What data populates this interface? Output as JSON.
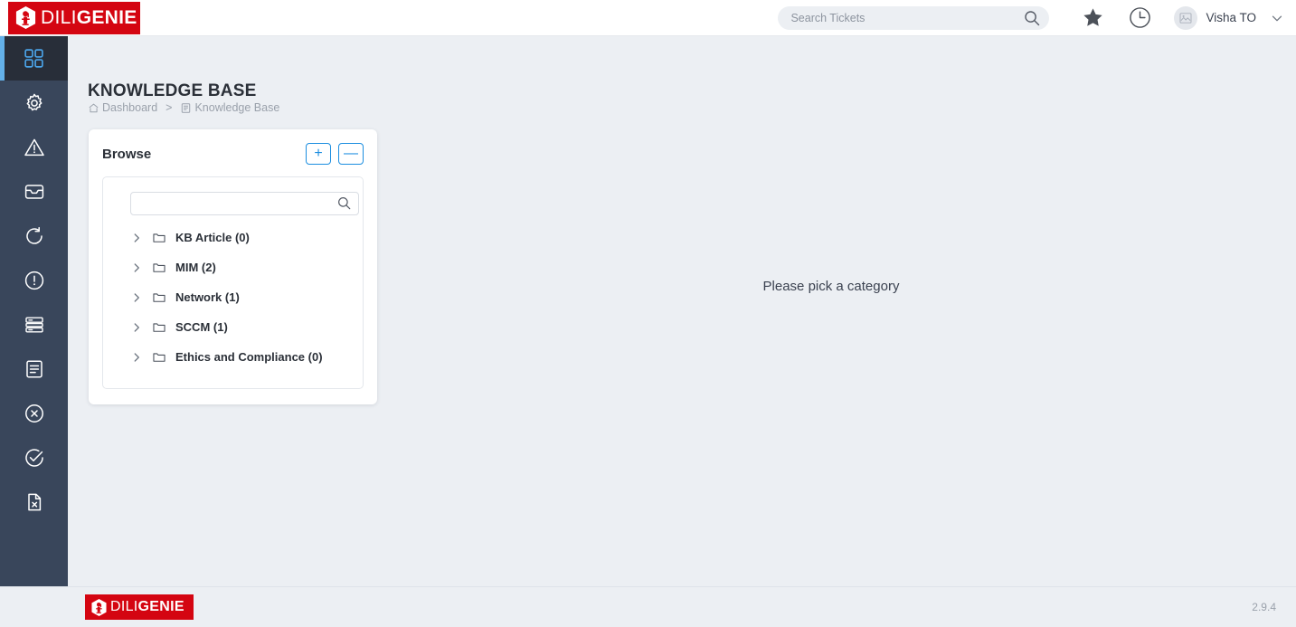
{
  "brand": {
    "name_thin": "DILI",
    "name_bold": "GENIE",
    "logo_icon": "genie-hexagon-logo"
  },
  "header": {
    "search": {
      "placeholder": "Search Tickets",
      "value": "",
      "icon": "search-icon"
    },
    "star_icon": "star-icon",
    "clock_icon": "clock-history-icon",
    "avatar_icon": "user-avatar-placeholder",
    "user_name": "Visha TO",
    "caret_icon": "chevron-down-icon"
  },
  "sidebar": {
    "items": [
      {
        "icon": "dashboard-grid-icon",
        "name": "dashboard",
        "active": true
      },
      {
        "icon": "gear-icon",
        "name": "settings",
        "active": false
      },
      {
        "icon": "warning-triangle-icon",
        "name": "incidents",
        "active": false
      },
      {
        "icon": "inbox-icon",
        "name": "inbox",
        "active": false
      },
      {
        "icon": "refresh-icon",
        "name": "changes",
        "active": false
      },
      {
        "icon": "exclamation-circle-icon",
        "name": "problems",
        "active": false
      },
      {
        "icon": "server-stack-icon",
        "name": "assets",
        "active": false
      },
      {
        "icon": "document-list-icon",
        "name": "knowledge",
        "active": false
      },
      {
        "icon": "x-circle-icon",
        "name": "rejected",
        "active": false
      },
      {
        "icon": "check-circle-icon",
        "name": "approved",
        "active": false
      },
      {
        "icon": "file-x-icon",
        "name": "reports",
        "active": false
      }
    ]
  },
  "page": {
    "title": "KNOWLEDGE BASE",
    "breadcrumb": [
      {
        "label": "Dashboard",
        "icon": "home-icon"
      },
      {
        "label": "Knowledge Base",
        "icon": "book-icon"
      }
    ],
    "breadcrumb_separator": ">"
  },
  "browse": {
    "title": "Browse",
    "expand_all_label": "+",
    "collapse_all_label": "—",
    "search": {
      "placeholder": "",
      "value": "",
      "icon": "search-icon"
    },
    "tree": [
      {
        "label": "KB Article (0)",
        "chevron": "chevron-right-icon",
        "folder": "folder-icon"
      },
      {
        "label": "MIM (2)",
        "chevron": "chevron-right-icon",
        "folder": "folder-icon"
      },
      {
        "label": "Network (1)",
        "chevron": "chevron-right-icon",
        "folder": "folder-icon"
      },
      {
        "label": "SCCM (1)",
        "chevron": "chevron-right-icon",
        "folder": "folder-icon"
      },
      {
        "label": "Ethics and Compliance (0)",
        "chevron": "chevron-right-icon",
        "folder": "folder-icon"
      }
    ]
  },
  "main": {
    "empty_message": "Please pick a category"
  },
  "footer": {
    "version": "2.9.4"
  },
  "colors": {
    "brand_red": "#d40511",
    "accent_blue": "#1c8ee0",
    "rail_bg": "#39465b",
    "rail_active_bg": "#282e39",
    "rail_active_bar": "#63b0e8",
    "page_bg": "#eceff3",
    "text_dark": "#2b3038",
    "text_muted": "#9aa1ab"
  }
}
